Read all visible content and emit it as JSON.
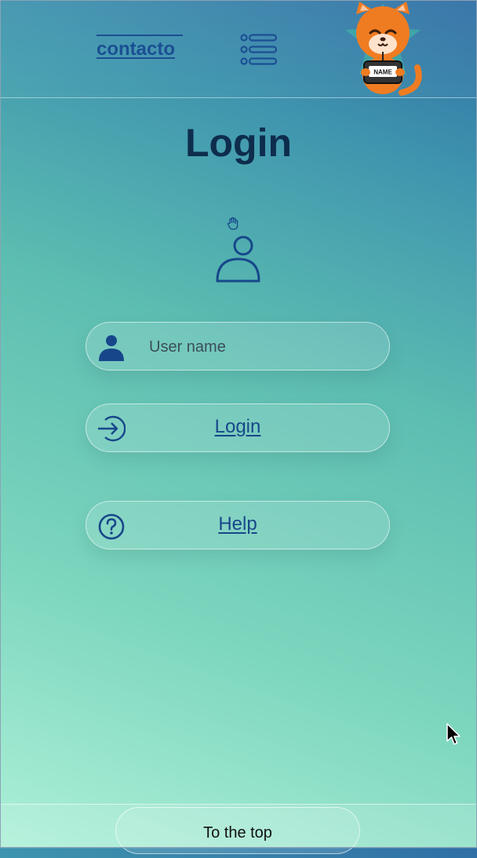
{
  "header": {
    "contact_link": "contacto",
    "menu_icon": "list-icon",
    "mascot": {
      "badge_text": "NAME",
      "icon": "cat-mascot-icon"
    }
  },
  "main": {
    "title": "Login",
    "hand_icon": "hand-icon",
    "user_icon": "user-outline-icon",
    "username": {
      "placeholder": "User name",
      "value": "",
      "icon": "user-solid-icon"
    },
    "login_button": {
      "label": "Login",
      "icon": "sign-in-arrow-icon"
    },
    "help_button": {
      "label": "Help",
      "icon": "question-circle-icon"
    }
  },
  "footer": {
    "to_top_label": "To the top"
  },
  "colors": {
    "accent": "#1b4f93",
    "title": "#0e2d4d",
    "mascot_orange": "#f07c22",
    "star": "#3fa9a8"
  }
}
